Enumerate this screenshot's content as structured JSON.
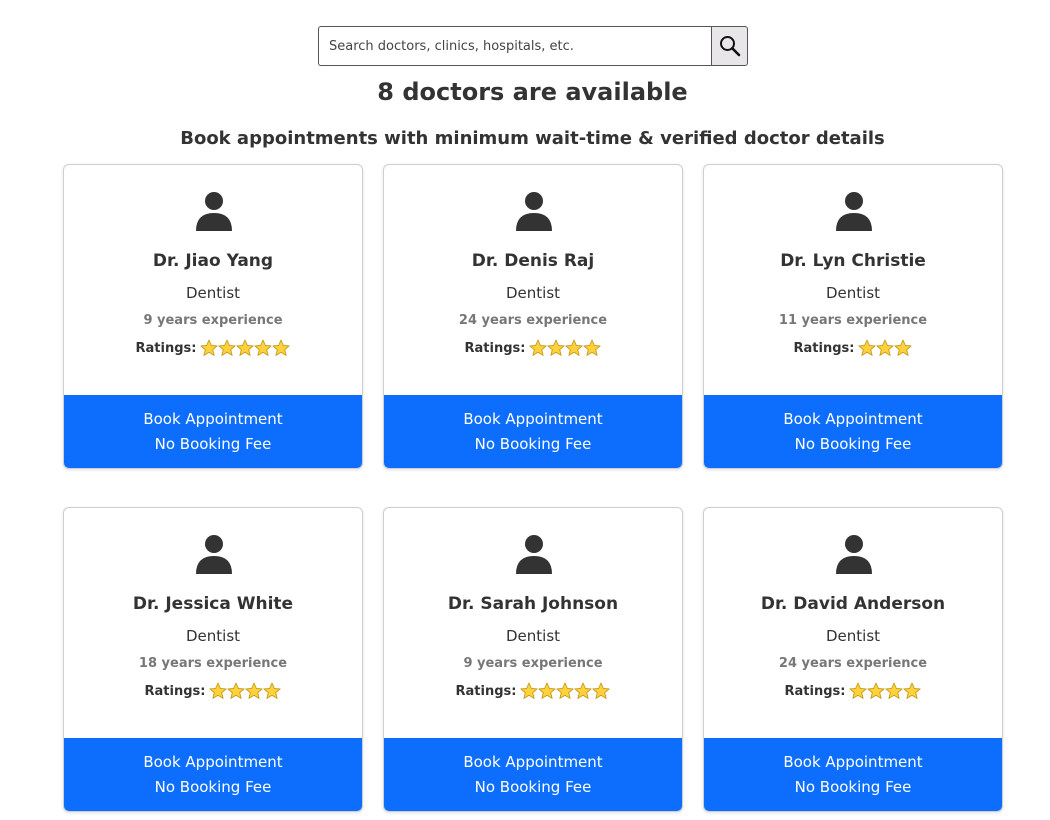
{
  "search": {
    "placeholder": "Search doctors, clinics, hospitals, etc.",
    "value": "",
    "button_icon": "search-icon"
  },
  "header": {
    "count_text": "8 doctors are available",
    "subtitle": "Book appointments with minimum wait-time & verified doctor details"
  },
  "colors": {
    "accent": "#0d6efd",
    "star_fill": "#ffd23c",
    "star_stroke": "#c79a1a",
    "avatar": "#333333"
  },
  "ratings_label": "Ratings:",
  "doctors": [
    {
      "name": "Dr. Jiao Yang",
      "specialty": "Dentist",
      "experience": "9 years experience",
      "rating": 5,
      "button_line1": "Book Appointment",
      "button_line2": "No Booking Fee"
    },
    {
      "name": "Dr. Denis Raj",
      "specialty": "Dentist",
      "experience": "24 years experience",
      "rating": 4,
      "button_line1": "Book Appointment",
      "button_line2": "No Booking Fee"
    },
    {
      "name": "Dr. Lyn Christie",
      "specialty": "Dentist",
      "experience": "11 years experience",
      "rating": 3,
      "button_line1": "Book Appointment",
      "button_line2": "No Booking Fee"
    },
    {
      "name": "Dr. Jessica White",
      "specialty": "Dentist",
      "experience": "18 years experience",
      "rating": 4,
      "button_line1": "Book Appointment",
      "button_line2": "No Booking Fee"
    },
    {
      "name": "Dr. Sarah Johnson",
      "specialty": "Dentist",
      "experience": "9 years experience",
      "rating": 5,
      "button_line1": "Book Appointment",
      "button_line2": "No Booking Fee"
    },
    {
      "name": "Dr. David Anderson",
      "specialty": "Dentist",
      "experience": "24 years experience",
      "rating": 4,
      "button_line1": "Book Appointment",
      "button_line2": "No Booking Fee"
    }
  ]
}
